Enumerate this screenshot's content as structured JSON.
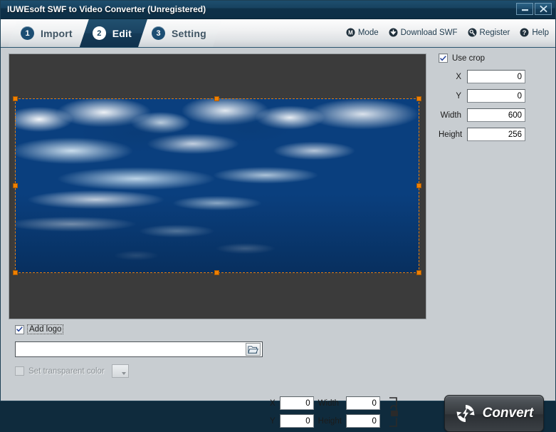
{
  "window": {
    "title": "IUWEsoft SWF to Video Converter (Unregistered)",
    "minimize_label": "Minimize",
    "close_label": "Close"
  },
  "tabs": [
    {
      "number": "1",
      "label": "Import",
      "active": false
    },
    {
      "number": "2",
      "label": "Edit",
      "active": true
    },
    {
      "number": "3",
      "label": "Setting",
      "active": false
    }
  ],
  "menu": [
    {
      "label": "Mode",
      "icon": "mode-icon"
    },
    {
      "label": "Download SWF",
      "icon": "download-icon"
    },
    {
      "label": "Register",
      "icon": "key-icon"
    },
    {
      "label": "Help",
      "icon": "help-icon"
    }
  ],
  "crop": {
    "use_crop_label": "Use crop",
    "use_crop_checked": "true",
    "fields": [
      {
        "label": "X",
        "value": "0"
      },
      {
        "label": "Y",
        "value": "0"
      },
      {
        "label": "Width",
        "value": "600"
      },
      {
        "label": "Height",
        "value": "256"
      }
    ]
  },
  "logo": {
    "add_logo_label": "Add logo",
    "add_logo_checked": "true",
    "path_value": "",
    "path_placeholder": "",
    "browse_label": "Browse",
    "transparent_label": "Set transparent color",
    "transparent_checked": "false",
    "transparent_enabled": "false",
    "coords": [
      {
        "label": "X",
        "value": "0"
      },
      {
        "label": "Width",
        "value": "0"
      },
      {
        "label": "Y",
        "value": "0"
      },
      {
        "label": "Height",
        "value": "0"
      }
    ],
    "lock_aspect_label": "Lock aspect ratio"
  },
  "convert": {
    "label": "Convert"
  },
  "colors": {
    "titlebar": "#17425f",
    "active_tab": "#1a4362",
    "panel": "#c8cdd1",
    "preview_bg": "#3b3b3b",
    "crop_handle": "#f08000",
    "accent": "#1c4e73"
  }
}
